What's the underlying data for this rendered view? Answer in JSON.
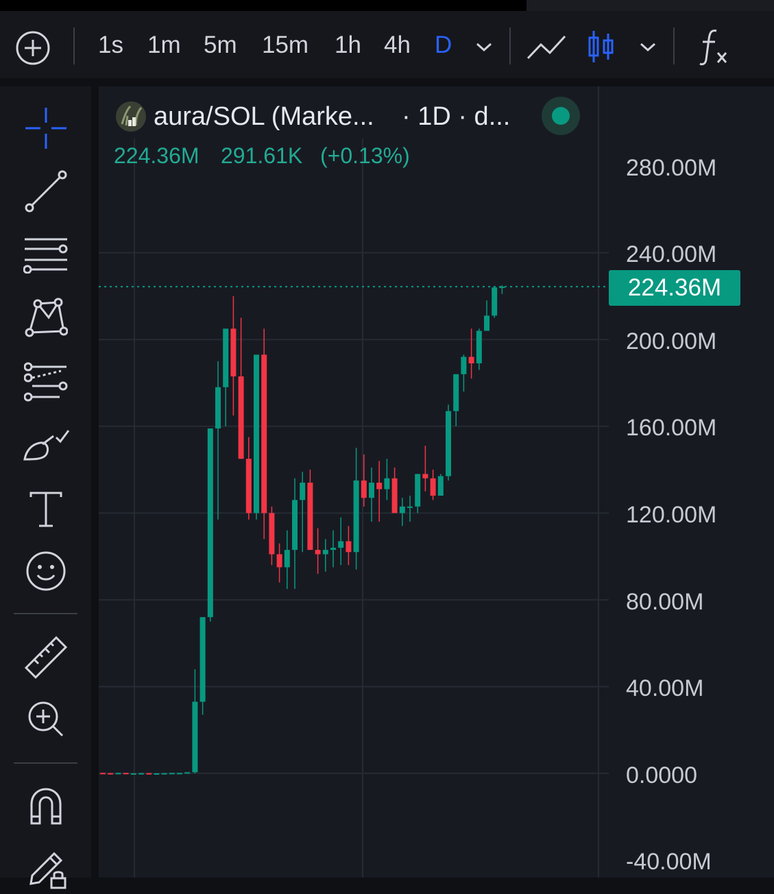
{
  "toolbar": {
    "timeframes": [
      "1s",
      "1m",
      "5m",
      "15m",
      "1h",
      "4h",
      "D"
    ],
    "active_timeframe": "D",
    "icons": [
      "add-circle-icon",
      "chevron-down-icon",
      "line-chart-icon",
      "candles-icon",
      "chevron-down-icon",
      "fx-indicators-icon"
    ]
  },
  "sidebar": {
    "tools": [
      "crosshair-icon",
      "trendline-icon",
      "horizontal-lines-icon",
      "pattern-icon",
      "fib-icon",
      "brush-icon",
      "text-icon",
      "emoji-icon",
      "ruler-icon",
      "zoom-in-icon",
      "magnet-icon",
      "edit-lock-icon"
    ]
  },
  "legend": {
    "symbol_title": "aura/SOL (Marke...",
    "interval_and_source": "· 1D · d...",
    "last_price": "224.36M",
    "change": "291.61K",
    "change_pct": "(+0.13%)",
    "live_status_color": "#089981"
  },
  "price_axis": {
    "labels": [
      "280.00M",
      "240.00M",
      "200.00M",
      "160.00M",
      "120.00M",
      "80.00M",
      "40.00M",
      "0.0000",
      "-40.00M"
    ],
    "current_price_tag": "224.36M"
  },
  "colors": {
    "up": "#089981",
    "down": "#f23645",
    "accent": "#2962ff"
  },
  "chart_data": {
    "type": "candlestick",
    "y_unit": "M",
    "ylim": [
      -40,
      280
    ],
    "grid": true,
    "last_price": 224.36,
    "ohlc": [
      [
        0.2,
        0.3,
        -0.1,
        0.1
      ],
      [
        0.1,
        0.2,
        -0.1,
        0.0
      ],
      [
        0.0,
        0.3,
        -0.1,
        0.2
      ],
      [
        0.2,
        0.2,
        -0.1,
        0.0
      ],
      [
        0.0,
        0.1,
        -0.2,
        0.0
      ],
      [
        0.0,
        0.2,
        -0.1,
        0.1
      ],
      [
        0.1,
        0.1,
        -0.1,
        0.0
      ],
      [
        0.0,
        0.1,
        -0.1,
        0.0
      ],
      [
        0.0,
        0.1,
        -0.1,
        0.1
      ],
      [
        0.1,
        0.2,
        0.0,
        0.2
      ],
      [
        0.2,
        0.2,
        0.0,
        0.2
      ],
      [
        0.2,
        0.4,
        0.0,
        0.5
      ],
      [
        0.5,
        48,
        0,
        33
      ],
      [
        33,
        72,
        27,
        72
      ],
      [
        72,
        141,
        70,
        159
      ],
      [
        159,
        190,
        117,
        178
      ],
      [
        178,
        195,
        160,
        205
      ],
      [
        205,
        220,
        165,
        183
      ],
      [
        183,
        210,
        145,
        145
      ],
      [
        145,
        155,
        117,
        120
      ],
      [
        120,
        190,
        117,
        193
      ],
      [
        193,
        205,
        108,
        120
      ],
      [
        120,
        123,
        96,
        101
      ],
      [
        101,
        106,
        88,
        95
      ],
      [
        95,
        112,
        85,
        103
      ],
      [
        103,
        136,
        85,
        126
      ],
      [
        126,
        139,
        102,
        134
      ],
      [
        134,
        140,
        110,
        103
      ],
      [
        103,
        113,
        92,
        101
      ],
      [
        101,
        108,
        93,
        103
      ],
      [
        103,
        112,
        95,
        104
      ],
      [
        104,
        118,
        96,
        107
      ],
      [
        107,
        114,
        96,
        102
      ],
      [
        102,
        150,
        94,
        135
      ],
      [
        135,
        147,
        123,
        127
      ],
      [
        127,
        141,
        116,
        134
      ],
      [
        134,
        144,
        116,
        131
      ],
      [
        131,
        145,
        126,
        136
      ],
      [
        136,
        141,
        120,
        120
      ],
      [
        120,
        127,
        114,
        123
      ],
      [
        123,
        128,
        116,
        123
      ],
      [
        123,
        138,
        120,
        138
      ],
      [
        138,
        151,
        130,
        136
      ],
      [
        136,
        140,
        126,
        128
      ],
      [
        128,
        138,
        128,
        137
      ],
      [
        137,
        170,
        135,
        167
      ],
      [
        167,
        184,
        160,
        184
      ],
      [
        184,
        193,
        176,
        192
      ],
      [
        192,
        205,
        182,
        189
      ],
      [
        189,
        205,
        186,
        204
      ],
      [
        204,
        218,
        206,
        211
      ],
      [
        211,
        224,
        210,
        224
      ],
      [
        224,
        225,
        221,
        224.36
      ]
    ]
  }
}
